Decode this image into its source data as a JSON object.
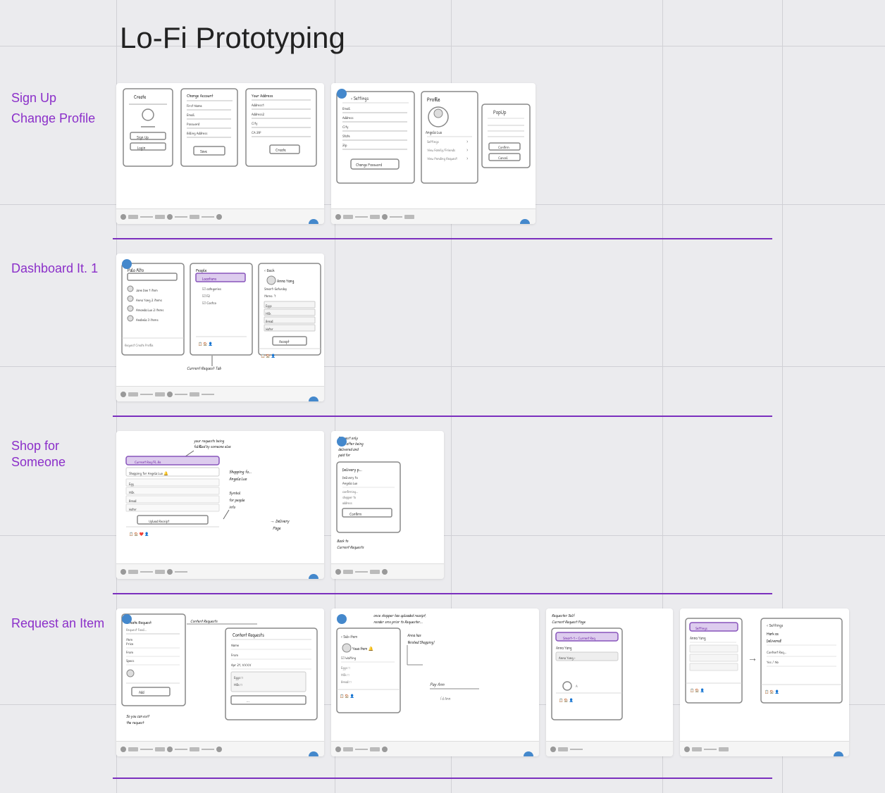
{
  "page": {
    "title": "Lo-Fi Prototyping",
    "background": "#ebebee"
  },
  "sections": [
    {
      "id": "signup",
      "labels": [
        "Sign Up",
        "Change Profile"
      ],
      "wireframe_count": 2
    },
    {
      "id": "dashboard",
      "labels": [
        "Dashboard It. 1"
      ],
      "wireframe_count": 1
    },
    {
      "id": "shopfor",
      "labels": [
        "Shop for Someone"
      ],
      "wireframe_count": 2
    },
    {
      "id": "request",
      "labels": [
        "Request an Item"
      ],
      "wireframe_count": 4
    }
  ],
  "toolbar": {
    "items": [
      "pencil",
      "eraser",
      "line",
      "rect",
      "circle",
      "select",
      "zoom",
      "more"
    ]
  }
}
